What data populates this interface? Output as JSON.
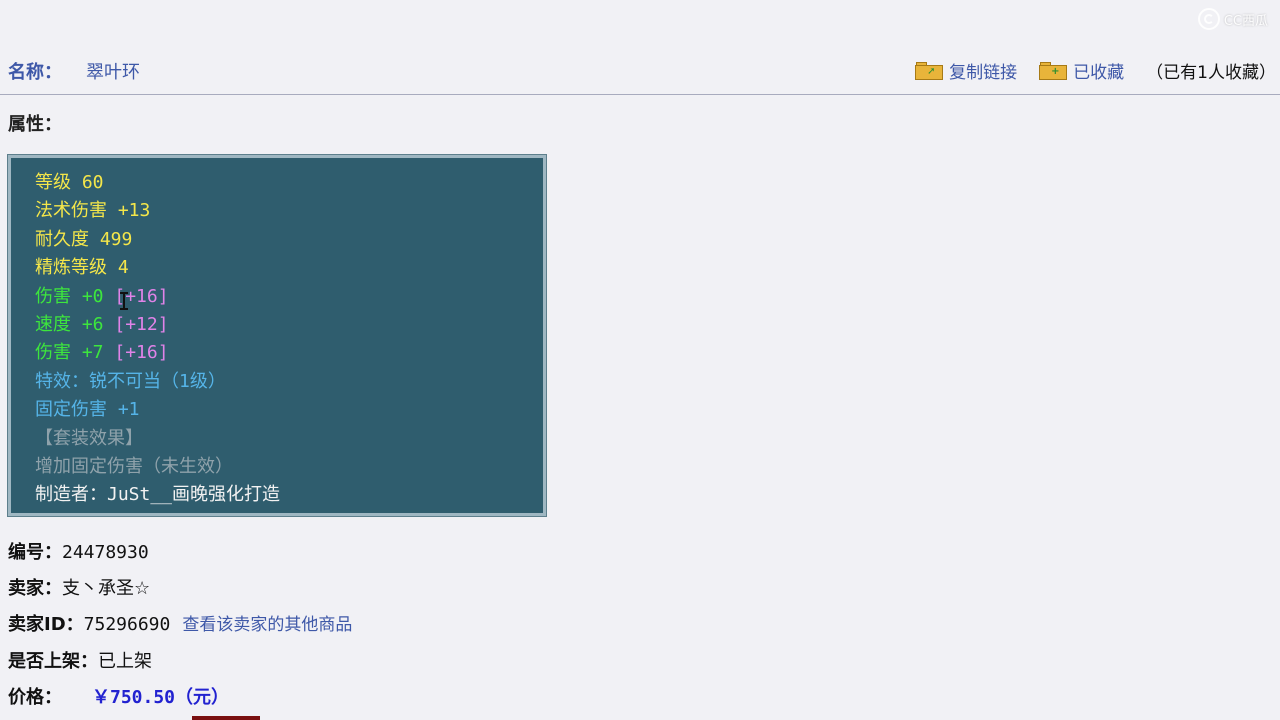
{
  "watermark": {
    "text": "CC西瓜"
  },
  "header": {
    "name_label": "名称：",
    "name_value": "翠叶环",
    "copy_link": "复制链接",
    "collected": "已收藏",
    "collect_note": "（已有1人收藏）"
  },
  "attributes_title": "属性：",
  "stats": [
    {
      "text": "等级 60",
      "color": "#f4e64a",
      "parts": []
    },
    {
      "text": "法术伤害 +13",
      "color": "#f4e64a",
      "parts": []
    },
    {
      "text": "耐久度 499",
      "color": "#f4e64a",
      "parts": []
    },
    {
      "text": "精炼等级 4",
      "color": "#f4e64a",
      "parts": []
    },
    {
      "text": "伤害 +0 ",
      "color": "#3de63d",
      "extra": "[+16]",
      "extra_color": "#e083e8"
    },
    {
      "text": "速度 +6 ",
      "color": "#3de63d",
      "extra": "[+12]",
      "extra_color": "#e083e8"
    },
    {
      "text": "伤害 +7 ",
      "color": "#3de63d",
      "extra": "[+16]",
      "extra_color": "#e083e8"
    },
    {
      "text": "特效：锐不可当（1级）",
      "color": "#55b4e8"
    },
    {
      "text": "固定伤害 +1",
      "color": "#55b4e8"
    },
    {
      "text": "【套装效果】",
      "color": "#8fa2ab"
    },
    {
      "text": "增加固定伤害（未生效）",
      "color": "#8fa2ab"
    },
    {
      "text": "制造者：JuSt__画晚强化打造",
      "color": "#f2f2f2"
    }
  ],
  "info": {
    "id_label": "编号：",
    "id_value": "24478930",
    "seller_label": "卖家：",
    "seller_value": "支丶承圣☆",
    "seller_id_label": "卖家ID：",
    "seller_id_value": "75296690",
    "seller_other_link": "查看该卖家的其他商品",
    "listed_label": "是否上架：",
    "listed_value": "已上架",
    "price_label": "价格：",
    "price_value": "￥750.50（元）"
  },
  "colors": {
    "accent": "#3e58a8",
    "panel_bg": "#2f5d6e",
    "price": "#2222d0"
  }
}
